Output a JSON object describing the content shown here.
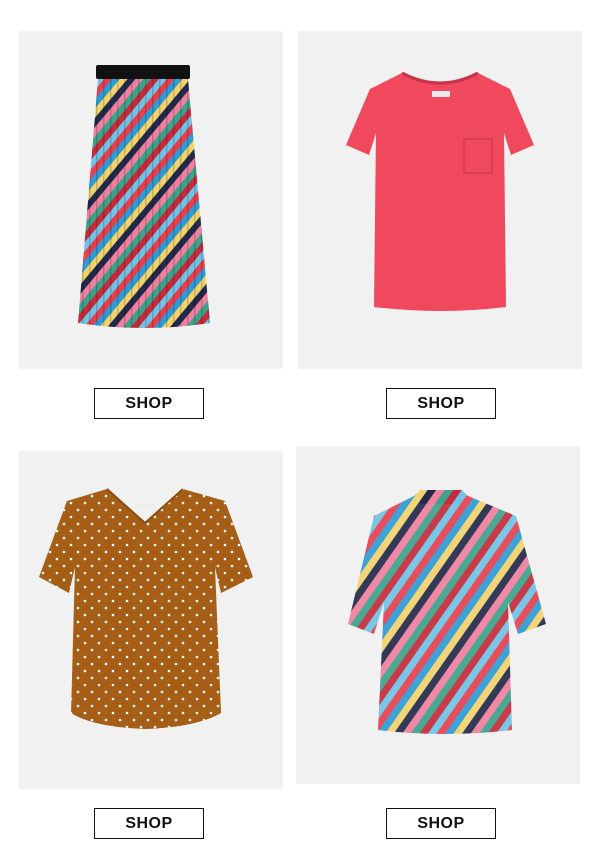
{
  "products": [
    {
      "name": "striped-pleated-skirt",
      "shop_label": "SHOP"
    },
    {
      "name": "coral-pocket-tee",
      "shop_label": "SHOP"
    },
    {
      "name": "polka-dot-vneck-blouse",
      "shop_label": "SHOP"
    },
    {
      "name": "striped-mock-neck-top",
      "shop_label": "SHOP"
    }
  ],
  "colors": {
    "card_bg": "#f1f1f1",
    "tee": "#f0485c",
    "blouse": "#a65e17",
    "stripes": [
      "#e6404f",
      "#2d9bd6",
      "#f2d36b",
      "#222a4a",
      "#f07fa0",
      "#3aa38a",
      "#c72b3b",
      "#6fc3e6"
    ]
  }
}
